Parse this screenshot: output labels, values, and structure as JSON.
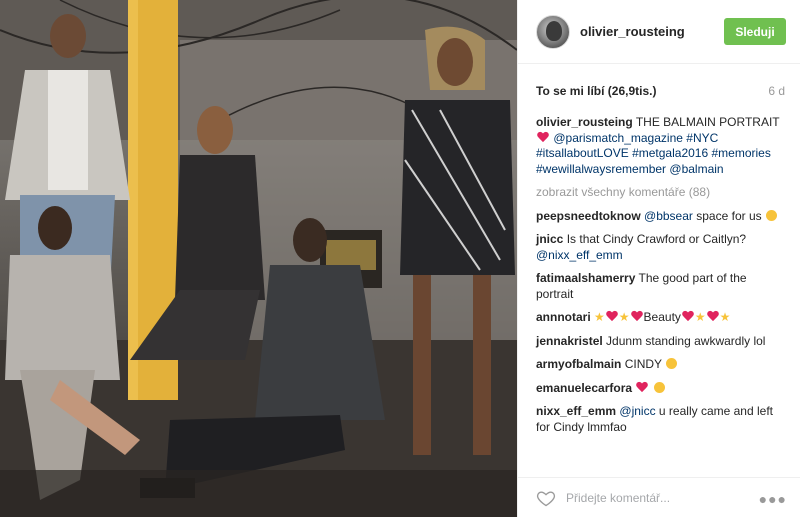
{
  "post": {
    "username": "olivier_rousteing",
    "follow_label": "Sleduji",
    "likes_label": "To se mi líbí (26,9tis.)",
    "time_ago": "6 d"
  },
  "caption": {
    "user": "olivier_rousteing",
    "text_part1": "THE BALMAIN PORTRAIT",
    "mention1": "@parismatch_magazine",
    "tag1": "#NYC",
    "tag2": "#itsallaboutLOVE",
    "tag3": "#metgala2016",
    "tag4": "#memories",
    "tag5": "#wewillalwaysremember",
    "mention2": "@balmain"
  },
  "view_all_comments": "zobrazit všechny komentáře (88)",
  "comments": [
    {
      "user": "peepsneedtoknow",
      "mention": "@bbsear",
      "text": "space for us"
    },
    {
      "user": "jnicc",
      "text": "Is that Cindy Crawford or Caitlyn?",
      "mention": "@nixx_eff_emm"
    },
    {
      "user": "fatimaalshamerry",
      "text": "The good part of the portrait"
    },
    {
      "user": "annnotari",
      "text": "Beauty"
    },
    {
      "user": "jennakristel",
      "text": "Jdunm standing awkwardly lol"
    },
    {
      "user": "armyofbalmain",
      "text": "CINDY"
    },
    {
      "user": "emanuelecarfora",
      "text": ""
    },
    {
      "user": "nixx_eff_emm",
      "mention": "@jnicc",
      "text": "u really came and left for Cindy lmmfao"
    }
  ],
  "footer": {
    "comment_placeholder": "Přidejte komentář..."
  },
  "colors": {
    "follow_button": "#70c050",
    "link": "#003569",
    "heart": "#e0245e"
  }
}
